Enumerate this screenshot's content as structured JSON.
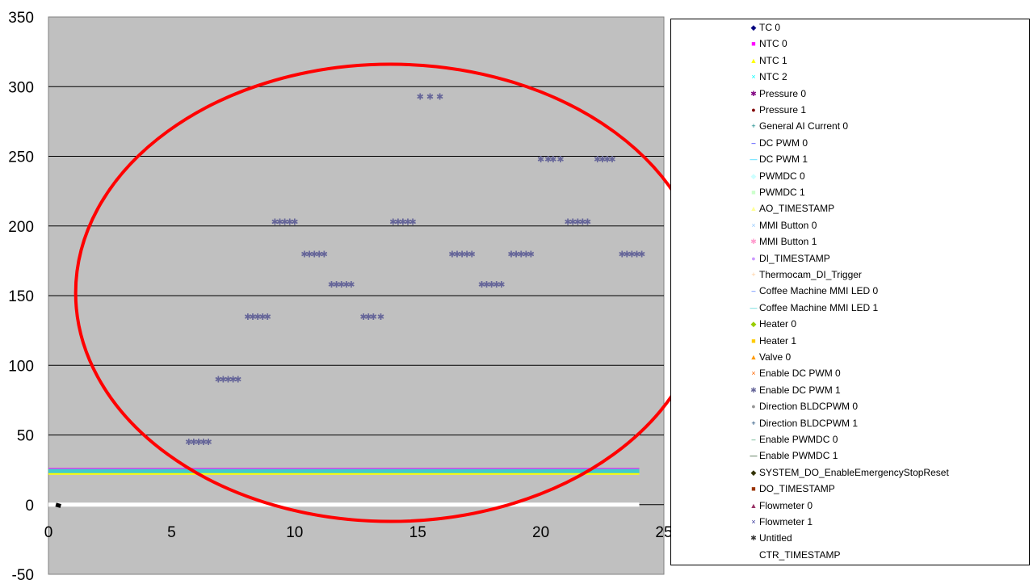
{
  "chart_data": {
    "type": "scatter",
    "title": "",
    "xlabel": "",
    "ylabel": "",
    "xlim": [
      0,
      25
    ],
    "ylim": [
      -50,
      350
    ],
    "x_ticks": [
      "0",
      "5",
      "10",
      "15",
      "20",
      "25"
    ],
    "y_ticks": [
      "-50",
      "0",
      "50",
      "100",
      "150",
      "200",
      "250",
      "300",
      "350"
    ],
    "x_tick_values": [
      0,
      5,
      10,
      15,
      20,
      25
    ],
    "y_tick_values": [
      -50,
      0,
      50,
      100,
      150,
      200,
      250,
      300,
      350
    ],
    "grid": "horizontal",
    "legend_position": "right",
    "highlight": {
      "shape": "ellipse",
      "color": "#ff0000"
    },
    "band": {
      "y_range": [
        22,
        26
      ],
      "x_range": [
        0,
        24
      ]
    },
    "baseline": {
      "y": 0,
      "x_range": [
        0,
        24
      ],
      "color": "#ffffff"
    },
    "series": [
      {
        "name": "TC 0",
        "marker": "◆",
        "color": "#000080"
      },
      {
        "name": "NTC 0",
        "marker": "■",
        "color": "#ff00ff"
      },
      {
        "name": "NTC 1",
        "marker": "▲",
        "color": "#ffff00"
      },
      {
        "name": "NTC 2",
        "marker": "×",
        "color": "#00ffff"
      },
      {
        "name": "Pressure 0",
        "marker": "✱",
        "color": "#800080"
      },
      {
        "name": "Pressure 1",
        "marker": "●",
        "color": "#800000"
      },
      {
        "name": "General AI Current 0",
        "marker": "+",
        "color": "#008080"
      },
      {
        "name": "DC PWM 0",
        "marker": "‒",
        "color": "#0000ff"
      },
      {
        "name": "DC PWM 1",
        "marker": "—",
        "color": "#00ccff"
      },
      {
        "name": "PWMDC 0",
        "marker": "◆",
        "color": "#ccffff"
      },
      {
        "name": "PWMDC 1",
        "marker": "■",
        "color": "#ccffcc"
      },
      {
        "name": "AO_TIMESTAMP",
        "marker": "▲",
        "color": "#ffff99"
      },
      {
        "name": "MMI Button 0",
        "marker": "×",
        "color": "#99ccff"
      },
      {
        "name": "MMI Button 1",
        "marker": "✱",
        "color": "#ff99cc"
      },
      {
        "name": "DI_TIMESTAMP",
        "marker": "●",
        "color": "#cc99ff"
      },
      {
        "name": "Thermocam_DI_Trigger",
        "marker": "+",
        "color": "#ffcc99"
      },
      {
        "name": "Coffee Machine MMI LED 0",
        "marker": "‒",
        "color": "#3366ff"
      },
      {
        "name": "Coffee Machine MMI LED 1",
        "marker": "—",
        "color": "#33cccc"
      },
      {
        "name": "Heater 0",
        "marker": "◆",
        "color": "#99cc00"
      },
      {
        "name": "Heater 1",
        "marker": "■",
        "color": "#ffcc00"
      },
      {
        "name": "Valve 0",
        "marker": "▲",
        "color": "#ff9900"
      },
      {
        "name": "Enable DC PWM 0",
        "marker": "×",
        "color": "#ff6600"
      },
      {
        "name": "Enable DC PWM 1",
        "marker": "✱",
        "color": "#666699",
        "points": [
          [
            5.7,
            45
          ],
          [
            5.9,
            45
          ],
          [
            6.1,
            45
          ],
          [
            6.3,
            45
          ],
          [
            6.5,
            45
          ],
          [
            6.9,
            90
          ],
          [
            7.1,
            90
          ],
          [
            7.3,
            90
          ],
          [
            7.5,
            90
          ],
          [
            7.7,
            90
          ],
          [
            8.1,
            135
          ],
          [
            8.3,
            135
          ],
          [
            8.5,
            135
          ],
          [
            8.7,
            135
          ],
          [
            8.9,
            135
          ],
          [
            9.2,
            203
          ],
          [
            9.4,
            203
          ],
          [
            9.6,
            203
          ],
          [
            9.8,
            203
          ],
          [
            10.0,
            203
          ],
          [
            10.4,
            180
          ],
          [
            10.6,
            180
          ],
          [
            10.8,
            180
          ],
          [
            11.0,
            180
          ],
          [
            11.2,
            180
          ],
          [
            11.5,
            158
          ],
          [
            11.7,
            158
          ],
          [
            11.9,
            158
          ],
          [
            12.1,
            158
          ],
          [
            12.3,
            158
          ],
          [
            12.8,
            135
          ],
          [
            13.0,
            135
          ],
          [
            13.2,
            135
          ],
          [
            13.5,
            135
          ],
          [
            14.0,
            203
          ],
          [
            14.2,
            203
          ],
          [
            14.4,
            203
          ],
          [
            14.6,
            203
          ],
          [
            14.8,
            203
          ],
          [
            15.1,
            293
          ],
          [
            15.5,
            293
          ],
          [
            15.9,
            293
          ],
          [
            16.4,
            180
          ],
          [
            16.6,
            180
          ],
          [
            16.8,
            180
          ],
          [
            17.0,
            180
          ],
          [
            17.2,
            180
          ],
          [
            17.6,
            158
          ],
          [
            17.8,
            158
          ],
          [
            18.0,
            158
          ],
          [
            18.2,
            158
          ],
          [
            18.4,
            158
          ],
          [
            18.8,
            180
          ],
          [
            19.0,
            180
          ],
          [
            19.2,
            180
          ],
          [
            19.4,
            180
          ],
          [
            19.6,
            180
          ],
          [
            20.0,
            248
          ],
          [
            20.3,
            248
          ],
          [
            20.5,
            248
          ],
          [
            20.8,
            248
          ],
          [
            21.1,
            203
          ],
          [
            21.3,
            203
          ],
          [
            21.5,
            203
          ],
          [
            21.7,
            203
          ],
          [
            21.9,
            203
          ],
          [
            22.3,
            248
          ],
          [
            22.5,
            248
          ],
          [
            22.7,
            248
          ],
          [
            22.9,
            248
          ],
          [
            23.3,
            180
          ],
          [
            23.5,
            180
          ],
          [
            23.7,
            180
          ],
          [
            23.9,
            180
          ],
          [
            24.1,
            180
          ]
        ]
      },
      {
        "name": "Direction BLDCPWM 0",
        "marker": "●",
        "color": "#969696"
      },
      {
        "name": "Direction BLDCPWM 1",
        "marker": "+",
        "color": "#003366"
      },
      {
        "name": "Enable PWMDC 0",
        "marker": "‒",
        "color": "#339966"
      },
      {
        "name": "Enable PWMDC 1",
        "marker": "—",
        "color": "#003300"
      },
      {
        "name": "SYSTEM_DO_EnableEmergencyStopReset",
        "marker": "◆",
        "color": "#333300"
      },
      {
        "name": "DO_TIMESTAMP",
        "marker": "■",
        "color": "#993300"
      },
      {
        "name": "Flowmeter 0",
        "marker": "▲",
        "color": "#993366"
      },
      {
        "name": "Flowmeter 1",
        "marker": "×",
        "color": "#333399"
      },
      {
        "name": "Untitled",
        "marker": "✱",
        "color": "#333333"
      },
      {
        "name": "CTR_TIMESTAMP",
        "marker": "",
        "color": "#ffffff"
      }
    ]
  }
}
